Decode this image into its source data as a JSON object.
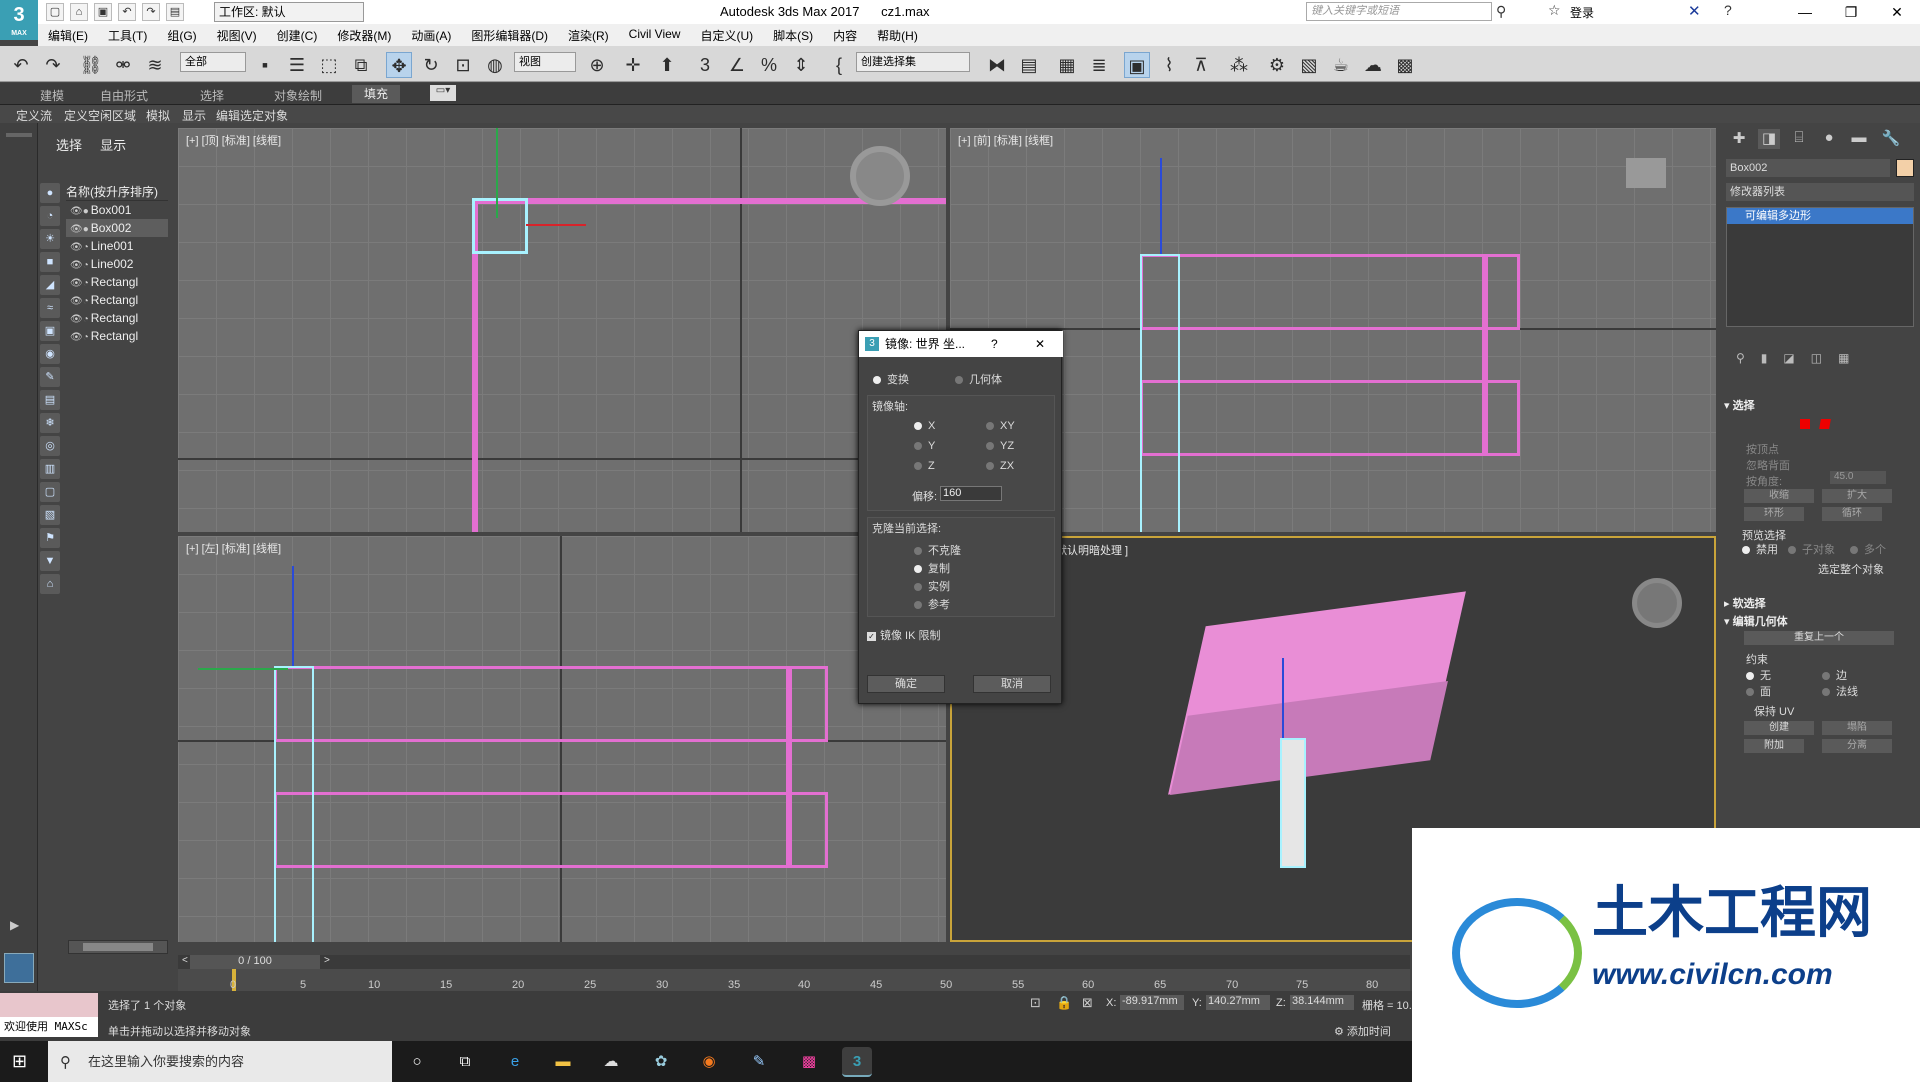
{
  "window": {
    "title": "Autodesk 3ds Max 2017",
    "file": "cz1.max",
    "workspace": "工作区: 默认",
    "search_placeholder": "键入关键字或短语",
    "login": "登录",
    "logo": "MAX"
  },
  "menu": [
    "编辑(E)",
    "工具(T)",
    "组(G)",
    "视图(V)",
    "创建(C)",
    "修改器(M)",
    "动画(A)",
    "图形编辑器(D)",
    "渲染(R)",
    "Civil View",
    "自定义(U)",
    "脚本(S)",
    "内容",
    "帮助(H)"
  ],
  "toolbar": {
    "filter": "全部",
    "refcoord": "视图",
    "selset": "创建选择集"
  },
  "ribbon": {
    "tabs": [
      "建模",
      "自由形式",
      "选择",
      "对象绘制",
      "填充"
    ],
    "active": "填充",
    "sub": [
      "定义流",
      "定义空闲区域",
      "模拟",
      "显示",
      "编辑选定对象"
    ]
  },
  "scene": {
    "tabs": [
      "选择",
      "显示"
    ],
    "column": "名称(按升序排序)",
    "items": [
      "Box001",
      "Box002",
      "Line001",
      "Line002",
      "Rectangl",
      "Rectangl",
      "Rectangl",
      "Rectangl"
    ],
    "selected": 1
  },
  "viewports": {
    "top": "[+] [顶] [标准] [线框]",
    "front": "[+] [前] [标准] [线框]",
    "left": "[+] [左] [标准] [线框]",
    "persp": "默认明暗处理 ]"
  },
  "dialog": {
    "title": "镜像: 世界 坐...",
    "help": "?",
    "close": "✕",
    "mode": [
      "变换",
      "几何体"
    ],
    "mode_sel": 0,
    "axis_label": "镜像轴:",
    "axes": [
      "X",
      "XY",
      "Y",
      "YZ",
      "Z",
      "ZX"
    ],
    "axis_sel": 0,
    "offset_label": "偏移:",
    "offset": "160",
    "clone_label": "克隆当前选择:",
    "clone": [
      "不克隆",
      "复制",
      "实例",
      "参考"
    ],
    "clone_sel": 1,
    "ik": "镜像 IK 限制",
    "ok": "确定",
    "cancel": "取消"
  },
  "cmd": {
    "name": "Box002",
    "color": "#f3d0a8",
    "modlist": "修改器列表",
    "stack": "可编辑多边形",
    "sel_title": "选择",
    "by_vertex": "按顶点",
    "ignore_back": "忽略背面",
    "angle_label": "按角度:",
    "angle": "45.0",
    "shrink": "收缩",
    "grow": "扩大",
    "ring": "环形",
    "loop": "循环",
    "preview": "预览选择",
    "preview_opts": [
      "禁用",
      "子对象",
      "多个"
    ],
    "sel_whole": "选定整个对象",
    "soft": "软选择",
    "edit_geom": "编辑几何体",
    "repeat": "重复上一个",
    "constraints": "约束",
    "con_opts": [
      "无",
      "边",
      "面",
      "法线"
    ],
    "keep_uv": "保持 UV",
    "create": "创建",
    "collapse": "塌陷",
    "attach": "附加",
    "detach": "分离"
  },
  "timeline": {
    "frame": "0 / 100",
    "ticks": [
      "0",
      "5",
      "10",
      "15",
      "20",
      "25",
      "30",
      "35",
      "40",
      "45",
      "50",
      "55",
      "60",
      "65",
      "70",
      "75",
      "80"
    ]
  },
  "status": {
    "line1": "选择了 1 个对象",
    "line2": "单击并拖动以选择并移动对象",
    "welcome": "欢迎使用 MAXSc",
    "x_label": "X:",
    "x": "-89.917mm",
    "y_label": "Y:",
    "y": "140.27mm",
    "z_label": "Z:",
    "z": "38.144mm",
    "grid": "栅格 = 10.",
    "addtime": "添加时间"
  },
  "taskbar": {
    "search": "在这里输入你要搜索的内容"
  },
  "watermark": {
    "brand": "土木工程网",
    "url": "www.civilcn.com"
  }
}
